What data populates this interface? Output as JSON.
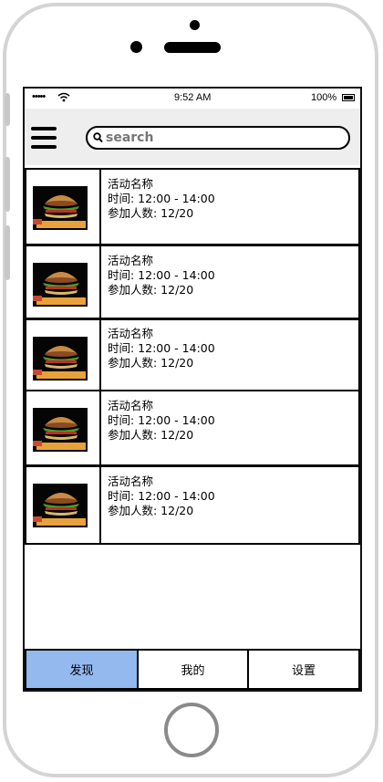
{
  "status_bar": {
    "signal": "•••••",
    "time": "9:52 AM",
    "battery": "100%",
    "icons": [
      "wifi-icon",
      "battery-icon"
    ]
  },
  "header": {
    "menu_icon": "hamburger-menu-icon",
    "search": {
      "icon": "search-icon",
      "placeholder": "search",
      "value": ""
    }
  },
  "events": [
    {
      "name": "活动名称",
      "time": "时间: 12:00 - 14:00",
      "participants": "参加人数: 12/20",
      "image": "burger-image"
    },
    {
      "name": "活动名称",
      "time": "时间: 12:00 - 14:00",
      "participants": "参加人数: 12/20",
      "image": "burger-image"
    },
    {
      "name": "活动名称",
      "time": "时间: 12:00 - 14:00",
      "participants": "参加人数: 12/20",
      "image": "burger-image"
    },
    {
      "name": "活动名称",
      "time": "时间: 12:00 - 14:00",
      "participants": "参加人数: 12/20",
      "image": "burger-image"
    },
    {
      "name": "活动名称",
      "time": "时间: 12:00 - 14:00",
      "participants": "参加人数: 12/20",
      "image": "burger-image"
    }
  ],
  "tabs": [
    {
      "label": "发现",
      "active": true
    },
    {
      "label": "我的",
      "active": false
    },
    {
      "label": "设置",
      "active": false
    }
  ],
  "colors": {
    "active_tab": "#93b9ee",
    "header_bg": "#eeeeee"
  }
}
